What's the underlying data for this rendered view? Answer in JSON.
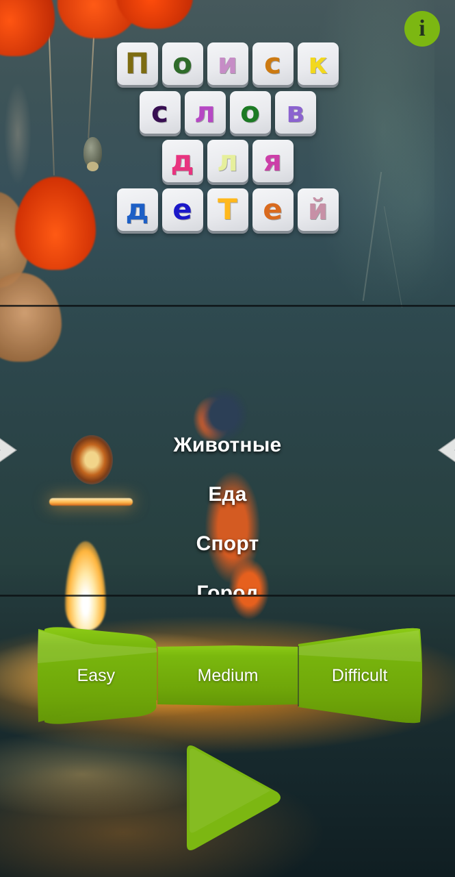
{
  "app": {
    "title_lines": [
      {
        "word": "Поиск",
        "letters": [
          {
            "char": "П",
            "color": "#7d6c12"
          },
          {
            "char": "о",
            "color": "#2f6b2a"
          },
          {
            "char": "и",
            "color": "#c68cc6"
          },
          {
            "char": "с",
            "color": "#cc7a12"
          },
          {
            "char": "к",
            "color": "#f2d81e"
          }
        ]
      },
      {
        "word": "слов",
        "letters": [
          {
            "char": "с",
            "color": "#380f52"
          },
          {
            "char": "л",
            "color": "#b648c4"
          },
          {
            "char": "о",
            "color": "#1c7a24"
          },
          {
            "char": "в",
            "color": "#8b63cf"
          }
        ]
      },
      {
        "word": "для",
        "letters": [
          {
            "char": "д",
            "color": "#e8337f"
          },
          {
            "char": "л",
            "color": "#e6ef9c"
          },
          {
            "char": "я",
            "color": "#cc3fa8"
          }
        ]
      },
      {
        "word": "детей",
        "letters": [
          {
            "char": "д",
            "color": "#1d5fc6"
          },
          {
            "char": "е",
            "color": "#1b18c9"
          },
          {
            "char": "Т",
            "color": "#ffb81c"
          },
          {
            "char": "е",
            "color": "#d96a1e"
          },
          {
            "char": "й",
            "color": "#c790a6"
          }
        ]
      }
    ]
  },
  "header": {
    "info_label": "i",
    "info_icon": "info-icon"
  },
  "nav": {
    "prev_icon": "chevron-right-icon",
    "next_icon": "chevron-left-icon"
  },
  "categories": {
    "items": [
      {
        "label": "Животные"
      },
      {
        "label": "Еда"
      },
      {
        "label": "Спорт"
      },
      {
        "label": "Город"
      }
    ]
  },
  "difficulty": {
    "accent_color": "#6fa609",
    "options": [
      {
        "label": "Easy"
      },
      {
        "label": "Medium"
      },
      {
        "label": "Difficult"
      }
    ]
  },
  "play": {
    "icon": "play-triangle-icon",
    "color": "#7cb712"
  }
}
